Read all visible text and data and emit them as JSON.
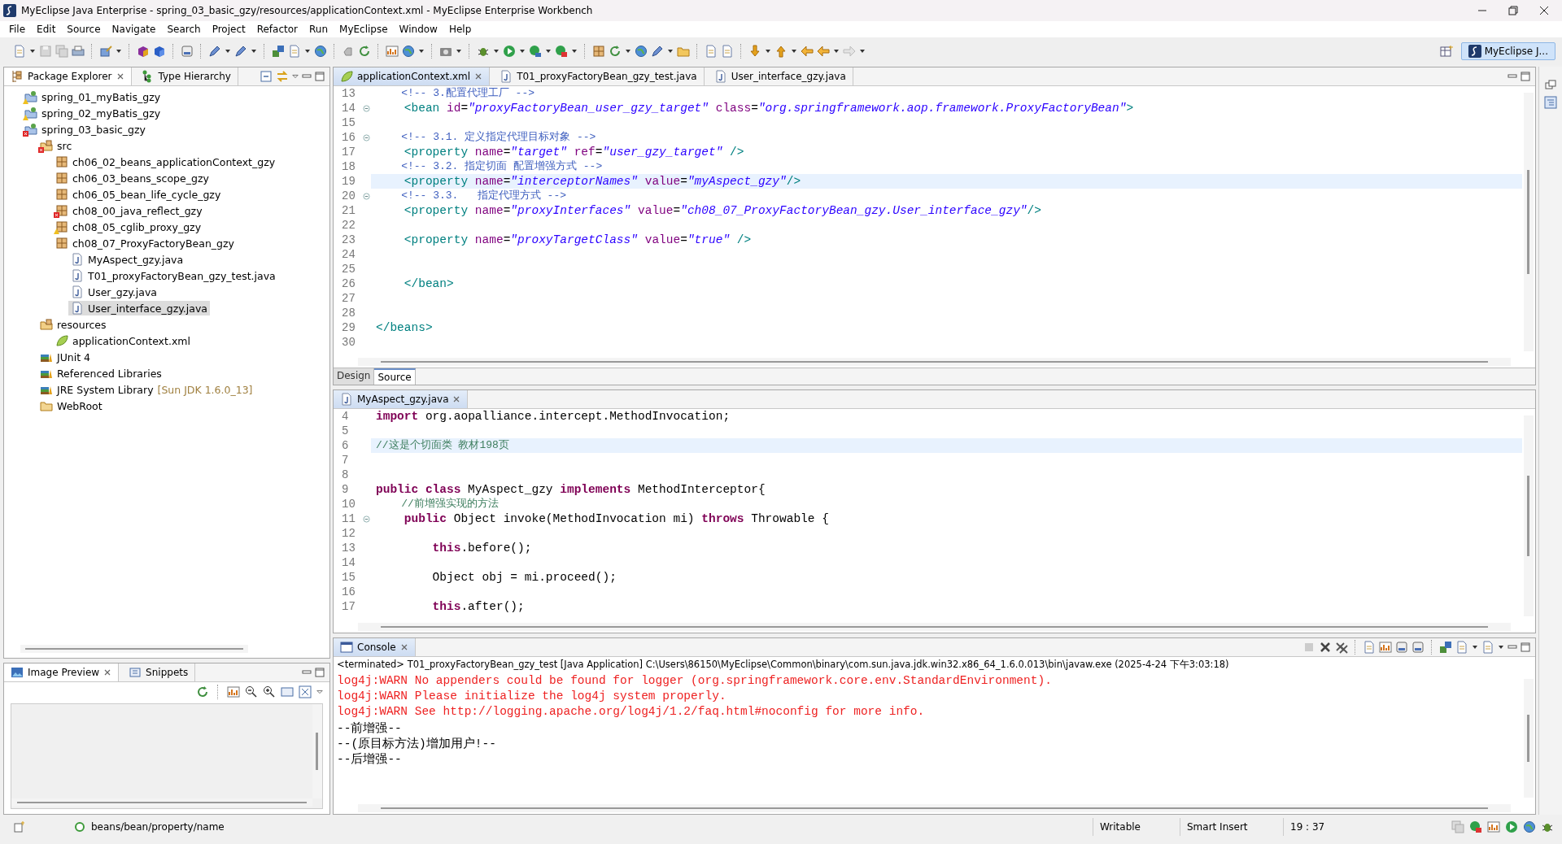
{
  "window": {
    "title": "MyEclipse Java Enterprise - spring_03_basic_gzy/resources/applicationContext.xml - MyEclipse Enterprise Workbench"
  },
  "menu": [
    "File",
    "Edit",
    "Source",
    "Navigate",
    "Search",
    "Project",
    "Refactor",
    "Run",
    "MyEclipse",
    "Window",
    "Help"
  ],
  "perspective": {
    "label": "MyEclipse J...",
    "selected": true
  },
  "explorer": {
    "tabs": [
      {
        "label": "Package Explorer",
        "selected": true
      },
      {
        "label": "Type Hierarchy",
        "selected": false
      }
    ],
    "tree": [
      {
        "kind": "project",
        "label": "spring_01_myBatis_gzy",
        "warning": true,
        "error": false,
        "selected": false
      },
      {
        "kind": "project",
        "label": "spring_02_myBatis_gzy",
        "warning": true,
        "error": false,
        "selected": false
      },
      {
        "kind": "project",
        "label": "spring_03_basic_gzy",
        "warning": false,
        "error": true,
        "selected": false,
        "children": [
          {
            "kind": "source",
            "label": "src",
            "warning": false,
            "error": true,
            "selected": false,
            "children": [
              {
                "kind": "package",
                "label": "ch06_02_beans_applicationContext_gzy",
                "warning": false,
                "error": false,
                "selected": false
              },
              {
                "kind": "package",
                "label": "ch06_03_beans_scope_gzy",
                "warning": false,
                "error": false,
                "selected": false
              },
              {
                "kind": "package",
                "label": "ch06_05_bean_life_cycle_gzy",
                "warning": false,
                "error": false,
                "selected": false
              },
              {
                "kind": "package",
                "label": "ch08_00_java_reflect_gzy",
                "warning": false,
                "error": true,
                "selected": false
              },
              {
                "kind": "package",
                "label": "ch08_05_cglib_proxy_gzy",
                "warning": true,
                "error": false,
                "selected": false
              },
              {
                "kind": "package",
                "label": "ch08_07_ProxyFactoryBean_gzy",
                "warning": false,
                "error": false,
                "selected": false,
                "children": [
                  {
                    "kind": "java",
                    "label": "MyAspect_gzy.java",
                    "warning": false,
                    "error": false,
                    "selected": false
                  },
                  {
                    "kind": "java",
                    "label": "T01_proxyFactoryBean_gzy_test.java",
                    "warning": false,
                    "error": false,
                    "selected": false
                  },
                  {
                    "kind": "java",
                    "label": "User_gzy.java",
                    "warning": false,
                    "error": false,
                    "selected": false
                  },
                  {
                    "kind": "java",
                    "label": "User_interface_gzy.java",
                    "warning": false,
                    "error": false,
                    "selected": true
                  }
                ]
              }
            ]
          },
          {
            "kind": "source",
            "label": "resources",
            "warning": false,
            "error": false,
            "selected": false,
            "children": [
              {
                "kind": "xml",
                "label": "applicationContext.xml",
                "warning": false,
                "error": false,
                "selected": false
              }
            ]
          },
          {
            "kind": "library",
            "label": "JUnit 4",
            "warning": false,
            "error": false,
            "selected": false
          },
          {
            "kind": "library",
            "label": "Referenced Libraries",
            "warning": false,
            "error": false,
            "selected": false
          },
          {
            "kind": "library",
            "label": "JRE System Library",
            "decoration": "[Sun JDK 1.6.0_13]",
            "warning": false,
            "error": false,
            "selected": false
          },
          {
            "kind": "folder",
            "label": "WebRoot",
            "warning": false,
            "error": false,
            "selected": false
          }
        ]
      }
    ]
  },
  "preview": {
    "tabs": [
      {
        "label": "Image Preview",
        "selected": true
      },
      {
        "label": "Snippets",
        "selected": false
      }
    ]
  },
  "xml_editor": {
    "tabs": [
      {
        "kind": "xml",
        "label": "applicationContext.xml",
        "selected": true
      },
      {
        "kind": "java",
        "label": "T01_proxyFactoryBean_gzy_test.java",
        "selected": false
      },
      {
        "kind": "java",
        "label": "User_interface_gzy.java",
        "selected": false
      }
    ],
    "lines": [
      {
        "n": "13",
        "fold": false,
        "current": false,
        "t": [
          {
            "kind": "comment",
            "text": "    <!-- 3.配置代理工厂 -->"
          }
        ]
      },
      {
        "n": "14",
        "fold": true,
        "current": false,
        "t": [
          {
            "kind": "tag",
            "text": "    <bean"
          },
          {
            "kind": "attr",
            "text": " id"
          },
          {
            "kind": "plain",
            "text": "="
          },
          {
            "kind": "str",
            "text": "\"proxyFactoryBean_user_gzy_target\""
          },
          {
            "kind": "attr",
            "text": " class"
          },
          {
            "kind": "plain",
            "text": "="
          },
          {
            "kind": "str",
            "text": "\"org.springframework.aop.framework.ProxyFactoryBean\""
          },
          {
            "kind": "tag",
            "text": ">"
          }
        ]
      },
      {
        "n": "15",
        "fold": false,
        "current": false
      },
      {
        "n": "16",
        "fold": true,
        "current": false,
        "t": [
          {
            "kind": "comment",
            "text": "    <!-- 3.1. 定义指定代理目标对象 -->"
          }
        ]
      },
      {
        "n": "17",
        "fold": false,
        "current": false,
        "t": [
          {
            "kind": "tag",
            "text": "    <property"
          },
          {
            "kind": "attr",
            "text": " name"
          },
          {
            "kind": "plain",
            "text": "="
          },
          {
            "kind": "str",
            "text": "\"target\""
          },
          {
            "kind": "attr",
            "text": " ref"
          },
          {
            "kind": "plain",
            "text": "="
          },
          {
            "kind": "str",
            "text": "\"user_gzy_target\""
          },
          {
            "kind": "tag",
            "text": " />"
          }
        ]
      },
      {
        "n": "18",
        "fold": false,
        "current": false,
        "t": [
          {
            "kind": "comment",
            "text": "    <!-- 3.2. 指定切面 配置增强方式 -->"
          }
        ]
      },
      {
        "n": "19",
        "fold": false,
        "current": true,
        "t": [
          {
            "kind": "tag",
            "text": "    <property"
          },
          {
            "kind": "attr",
            "text": " name"
          },
          {
            "kind": "plain",
            "text": "="
          },
          {
            "kind": "str",
            "text": "\"interceptorNames\""
          },
          {
            "kind": "attr",
            "text": " value"
          },
          {
            "kind": "plain",
            "text": "="
          },
          {
            "kind": "str",
            "text": "\"myAspect_gzy\""
          },
          {
            "kind": "tag",
            "text": "/>"
          }
        ]
      },
      {
        "n": "20",
        "fold": true,
        "current": false,
        "t": [
          {
            "kind": "comment",
            "text": "    <!-- 3.3.   指定代理方式 -->"
          }
        ]
      },
      {
        "n": "21",
        "fold": false,
        "current": false,
        "t": [
          {
            "kind": "tag",
            "text": "    <property"
          },
          {
            "kind": "attr",
            "text": " name"
          },
          {
            "kind": "plain",
            "text": "="
          },
          {
            "kind": "str",
            "text": "\"proxyInterfaces\""
          },
          {
            "kind": "attr",
            "text": " value"
          },
          {
            "kind": "plain",
            "text": "="
          },
          {
            "kind": "str",
            "text": "\"ch08_07_ProxyFactoryBean_gzy.User_interface_gzy\""
          },
          {
            "kind": "tag",
            "text": "/>"
          }
        ]
      },
      {
        "n": "22",
        "fold": false,
        "current": false
      },
      {
        "n": "23",
        "fold": false,
        "current": false,
        "t": [
          {
            "kind": "tag",
            "text": "    <property"
          },
          {
            "kind": "attr",
            "text": " name"
          },
          {
            "kind": "plain",
            "text": "="
          },
          {
            "kind": "str",
            "text": "\"proxyTargetClass\""
          },
          {
            "kind": "attr",
            "text": " value"
          },
          {
            "kind": "plain",
            "text": "="
          },
          {
            "kind": "str",
            "text": "\"true\""
          },
          {
            "kind": "tag",
            "text": " />"
          }
        ]
      },
      {
        "n": "24",
        "fold": false,
        "current": false
      },
      {
        "n": "25",
        "fold": false,
        "current": false
      },
      {
        "n": "26",
        "fold": false,
        "current": false,
        "t": [
          {
            "kind": "tag",
            "text": "    </bean>"
          }
        ]
      },
      {
        "n": "27",
        "fold": false,
        "current": false
      },
      {
        "n": "28",
        "fold": false,
        "current": false
      },
      {
        "n": "29",
        "fold": false,
        "current": false,
        "t": [
          {
            "kind": "tag",
            "text": "</beans>"
          }
        ]
      },
      {
        "n": "30",
        "fold": false,
        "current": false
      }
    ],
    "page_tabs": [
      {
        "label": "Design",
        "selected": false
      },
      {
        "label": "Source",
        "selected": true
      }
    ]
  },
  "java_editor": {
    "tabs": [
      {
        "kind": "java",
        "label": "MyAspect_gzy.java",
        "selected": true
      }
    ],
    "lines": [
      {
        "n": "4",
        "fold": false,
        "current": false,
        "t": [
          {
            "kind": "kw",
            "text": "import"
          },
          {
            "kind": "plain",
            "text": " org.aopalliance.intercept.MethodInvocation;"
          }
        ]
      },
      {
        "n": "5",
        "fold": false,
        "current": false
      },
      {
        "n": "6",
        "fold": false,
        "current": true,
        "t": [
          {
            "kind": "jcomment",
            "text": "//这是个切面类 教材198页"
          }
        ]
      },
      {
        "n": "7",
        "fold": false,
        "current": false
      },
      {
        "n": "8",
        "fold": false,
        "current": false
      },
      {
        "n": "9",
        "fold": false,
        "current": false,
        "t": [
          {
            "kind": "kw",
            "text": "public class"
          },
          {
            "kind": "plain",
            "text": " MyAspect_gzy "
          },
          {
            "kind": "kw",
            "text": "implements"
          },
          {
            "kind": "plain",
            "text": " MethodInterceptor{"
          }
        ]
      },
      {
        "n": "10",
        "fold": false,
        "current": false,
        "t": [
          {
            "kind": "jcomment",
            "text": "    //前增强实现的方法"
          }
        ]
      },
      {
        "n": "11",
        "fold": true,
        "current": false,
        "t": [
          {
            "kind": "kw",
            "text": "    public"
          },
          {
            "kind": "plain",
            "text": " Object invoke(MethodInvocation mi) "
          },
          {
            "kind": "kw",
            "text": "throws"
          },
          {
            "kind": "plain",
            "text": " Throwable {"
          }
        ]
      },
      {
        "n": "12",
        "fold": false,
        "current": false
      },
      {
        "n": "13",
        "fold": false,
        "current": false,
        "t": [
          {
            "kind": "kw",
            "text": "        this"
          },
          {
            "kind": "plain",
            "text": ".before();"
          }
        ]
      },
      {
        "n": "14",
        "fold": false,
        "current": false
      },
      {
        "n": "15",
        "fold": false,
        "current": false,
        "t": [
          {
            "kind": "plain",
            "text": "        Object obj = mi.proceed();"
          }
        ]
      },
      {
        "n": "16",
        "fold": false,
        "current": false
      },
      {
        "n": "17",
        "fold": false,
        "current": false,
        "t": [
          {
            "kind": "kw",
            "text": "        this"
          },
          {
            "kind": "plain",
            "text": ".after();"
          }
        ]
      }
    ]
  },
  "console": {
    "tab": {
      "label": "Console",
      "selected": true
    },
    "header": "<terminated> T01_proxyFactoryBean_gzy_test [Java Application] C:\\Users\\86150\\MyEclipse\\Common\\binary\\com.sun.java.jdk.win32.x86_64_1.6.0.013\\bin\\javaw.exe (2025-4-24 下午3:03:18)",
    "lines": [
      {
        "kind": "error",
        "text": "log4j:WARN No appenders could be found for logger (org.springframework.core.env.StandardEnvironment)."
      },
      {
        "kind": "error",
        "text": "log4j:WARN Please initialize the log4j system properly."
      },
      {
        "kind": "error",
        "text": "log4j:WARN See http://logging.apache.org/log4j/1.2/faq.html#noconfig for more info."
      },
      {
        "kind": "out",
        "text": "--前增强--"
      },
      {
        "kind": "out",
        "text": "--(原目标方法)增加用户!--"
      },
      {
        "kind": "out",
        "text": "--后增强--"
      }
    ]
  },
  "status_bar": {
    "path": "beans/bean/property/name",
    "mode": "Writable",
    "insert": "Smart Insert",
    "position": "19 : 37"
  }
}
